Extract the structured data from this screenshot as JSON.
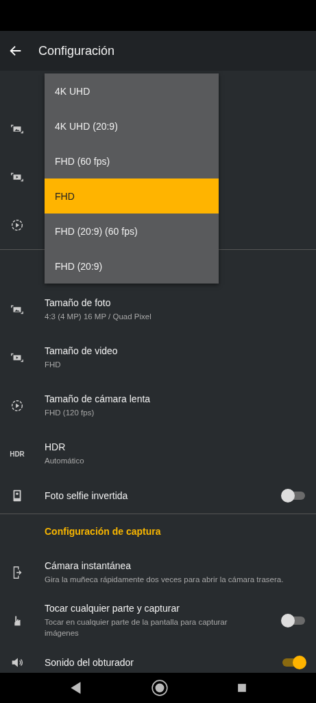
{
  "app_bar": {
    "title": "Configuración"
  },
  "dropdown": {
    "options": [
      {
        "label": "4K UHD",
        "selected": false
      },
      {
        "label": "4K UHD (20:9)",
        "selected": false
      },
      {
        "label": "FHD (60 fps)",
        "selected": false
      },
      {
        "label": "FHD",
        "selected": true
      },
      {
        "label": "FHD (20:9) (60 fps)",
        "selected": false
      },
      {
        "label": "FHD (20:9)",
        "selected": false
      }
    ]
  },
  "settings": [
    {
      "kind": "value",
      "title": "Tamaño de foto",
      "subtitle": "4:3 (4 MP) 16 MP / Quad Pixel"
    },
    {
      "kind": "value",
      "title": "Tamaño de video",
      "subtitle": "FHD"
    },
    {
      "kind": "value",
      "title": "Tamaño de cámara lenta",
      "subtitle": "FHD (120 fps)"
    },
    {
      "kind": "value",
      "icon_text": "HDR",
      "title": "HDR",
      "subtitle": "Automático"
    },
    {
      "kind": "toggle",
      "title": "Foto selfie invertida",
      "on": false
    },
    {
      "kind": "divider"
    },
    {
      "kind": "header",
      "title": "Configuración de captura"
    },
    {
      "kind": "value",
      "title": "Cámara instantánea",
      "subtitle": "Gira la muñeca rápidamente dos veces para abrir la cámara trasera."
    },
    {
      "kind": "toggle",
      "title": "Tocar cualquier parte y capturar",
      "subtitle": "Tocar en cualquier parte de la pantalla para capturar imágenes",
      "on": false
    },
    {
      "kind": "toggle",
      "title": "Sonido del obturador",
      "on": true
    }
  ]
}
